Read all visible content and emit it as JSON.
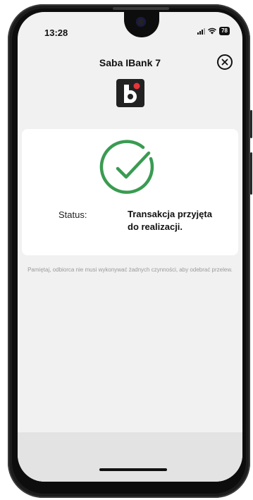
{
  "status_bar": {
    "time": "13:28",
    "battery": "78"
  },
  "header": {
    "title": "Saba IBank 7"
  },
  "status": {
    "label": "Status:",
    "value": "Transakcja przyjęta do realizacji."
  },
  "note": "Pamiętaj, odbiorca nie musi wykonywać żadnych czynności, aby odebrać przelew.",
  "colors": {
    "success_green": "#3a9b52",
    "logo_red": "#e8343a",
    "logo_bg": "#222222"
  }
}
